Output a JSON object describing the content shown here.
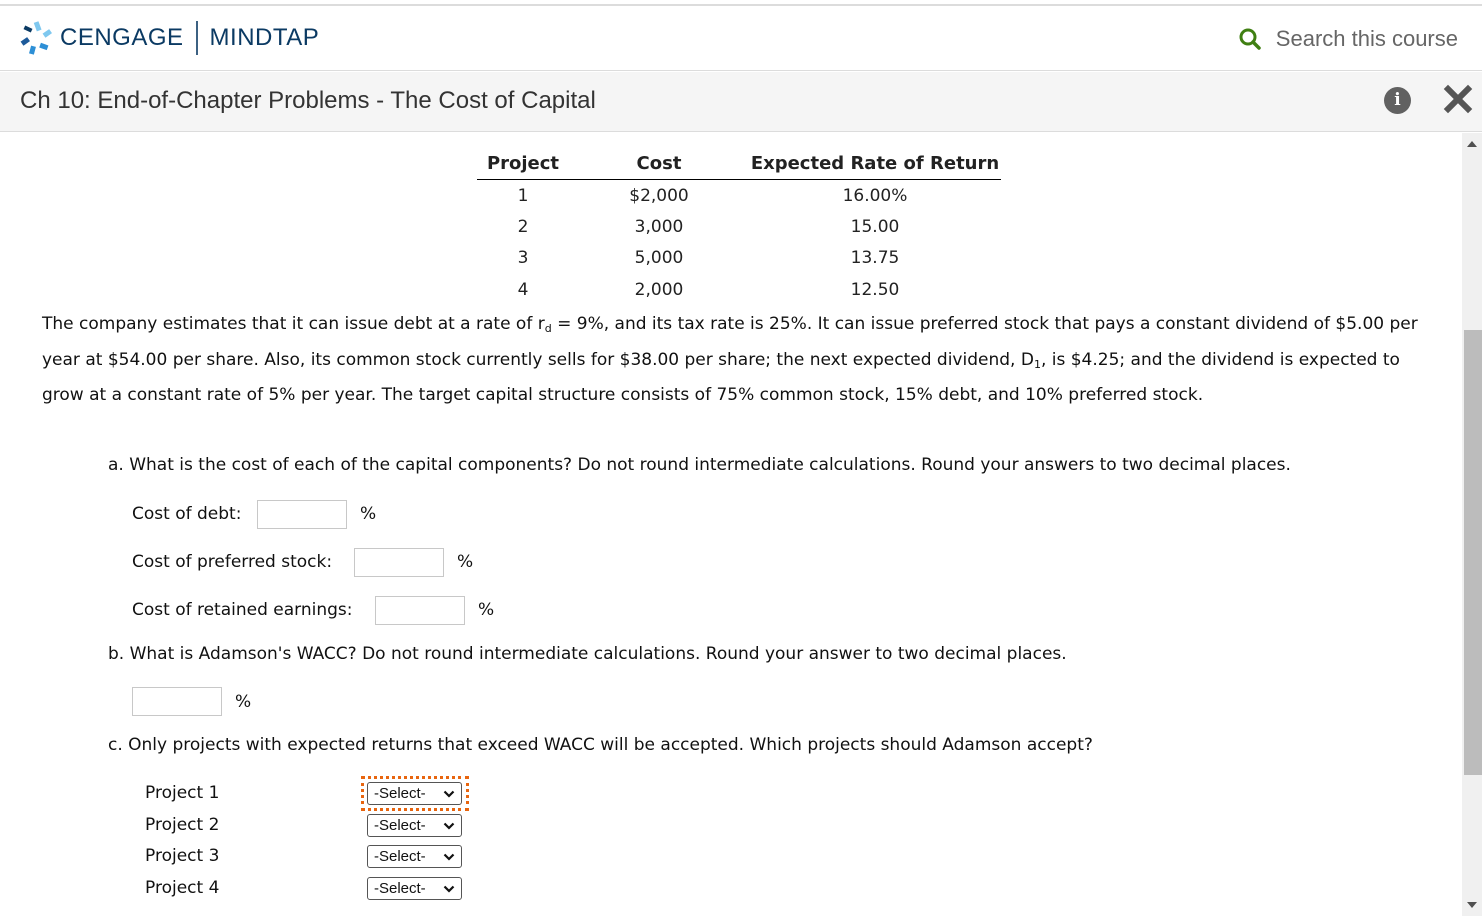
{
  "header": {
    "brand_primary": "CENGAGE",
    "brand_secondary": "MINDTAP",
    "search_placeholder": "Search this course",
    "colors": {
      "brand_navy": "#0b3a63",
      "search_icon": "#3f7f12",
      "focus_ring": "#e8650f"
    }
  },
  "titlebar": {
    "title": "Ch 10: End-of-Chapter Problems - The Cost of Capital",
    "info_icon": "info-icon",
    "close_icon": "close-icon"
  },
  "project_table": {
    "headers": [
      "Project",
      "Cost",
      "Expected Rate of Return"
    ],
    "rows": [
      [
        "1",
        "$2,000",
        "16.00%"
      ],
      [
        "2",
        "3,000",
        "15.00"
      ],
      [
        "3",
        "5,000",
        "13.75"
      ],
      [
        "4",
        "2,000",
        "12.50"
      ]
    ]
  },
  "problem": {
    "text_before_sub": "The company estimates that it can issue debt at a rate of r",
    "sub_d": "d",
    "text_after_sub": " = 9%, and its tax rate is 25%. It can issue preferred stock that pays a constant dividend of $5.00 per year at $54.00 per share. Also, its common stock currently sells for $38.00 per share; the next expected dividend, D",
    "sub_1": "1",
    "text_end": ", is $4.25; and the dividend is expected to grow at a constant rate of 5% per year. The target capital structure consists of 75% common stock, 15% debt, and 10% preferred stock."
  },
  "part_a": {
    "question": "a. What is the cost of each of the capital components? Do not round intermediate calculations. Round your answers to two decimal places.",
    "fields": [
      {
        "label": "Cost of debt:",
        "value": "",
        "unit": "%"
      },
      {
        "label": "Cost of preferred stock:",
        "value": "",
        "unit": "%"
      },
      {
        "label": "Cost of retained earnings:",
        "value": "",
        "unit": "%"
      }
    ]
  },
  "part_b": {
    "question": "b. What is Adamson's WACC? Do not round intermediate calculations. Round your answer to two decimal places.",
    "value": "",
    "unit": "%"
  },
  "part_c": {
    "question": "c. Only projects with expected returns that exceed WACC will be accepted. Which projects should Adamson accept?",
    "rows": [
      {
        "label": "Project 1",
        "selected": "-Select-"
      },
      {
        "label": "Project 2",
        "selected": "-Select-"
      },
      {
        "label": "Project 3",
        "selected": "-Select-"
      },
      {
        "label": "Project 4",
        "selected": "-Select-"
      }
    ]
  }
}
